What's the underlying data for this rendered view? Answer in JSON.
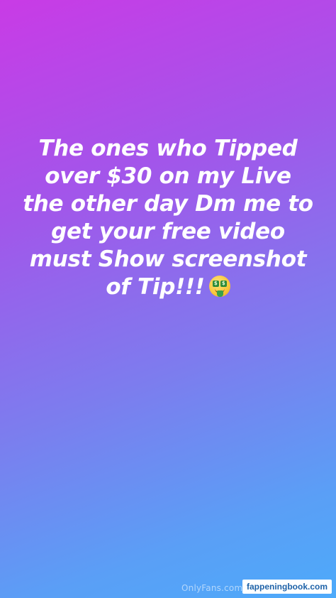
{
  "story": {
    "caption_lines": [
      "The ones who Tipped",
      "over $30 on my Live",
      "the other day Dm me to",
      "get your free video",
      "must Show screenshot",
      "of Tip!!!"
    ],
    "emoji": "money-mouth-face",
    "gradient_colors": [
      "#c93be6",
      "#a355ea",
      "#7d7cee",
      "#5a9ff6",
      "#4daafa"
    ]
  },
  "watermark": {
    "text": "OnlyFans.com/"
  },
  "site_badge": {
    "text": "fappeningbook.com"
  }
}
